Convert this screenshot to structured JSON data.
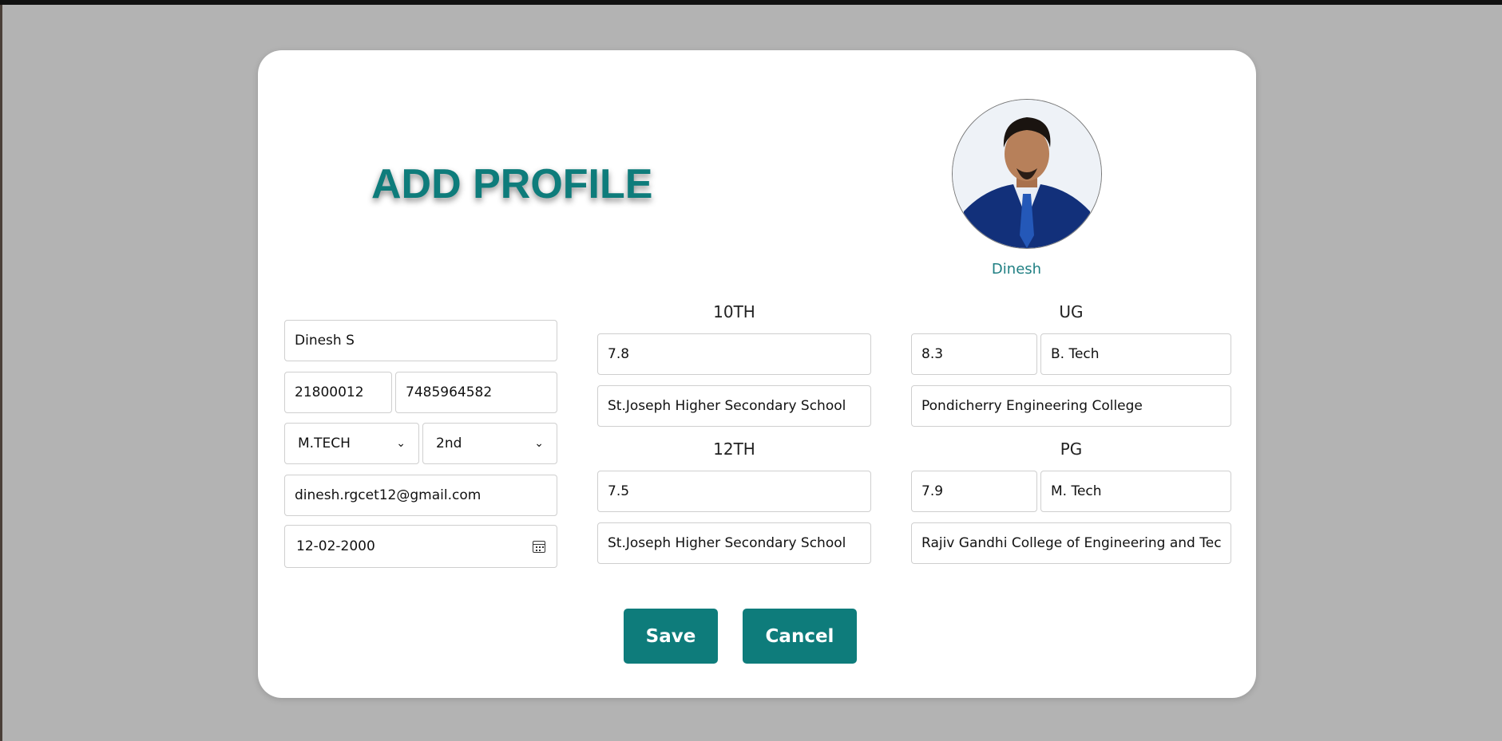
{
  "header": {
    "title": "ADD PROFILE"
  },
  "profile": {
    "display_name": "Dinesh"
  },
  "personal": {
    "full_name": "Dinesh S",
    "register_no": "21800012",
    "phone": "7485964582",
    "course": "M.TECH",
    "year": "2nd",
    "email": "dinesh.rgcet12@gmail.com",
    "dob": "12-02-2000"
  },
  "tenth": {
    "label": "10TH",
    "score": "7.8",
    "school": "St.Joseph Higher Secondary School"
  },
  "twelfth": {
    "label": "12TH",
    "score": "7.5",
    "school": "St.Joseph Higher Secondary School"
  },
  "ug": {
    "label": "UG",
    "score": "8.3",
    "degree": "B. Tech",
    "college": "Pondicherry Engineering College"
  },
  "pg": {
    "label": "PG",
    "score": "7.9",
    "degree": "M. Tech",
    "college": "Rajiv Gandhi College of Engineering and Tech"
  },
  "actions": {
    "save_label": "Save",
    "cancel_label": "Cancel"
  },
  "icons": {
    "dropdown": "chevron-down-icon",
    "calendar": "calendar-icon"
  },
  "colors": {
    "accent": "#0e7c7b",
    "backdrop": "#b3b3b3",
    "card": "#ffffff"
  }
}
